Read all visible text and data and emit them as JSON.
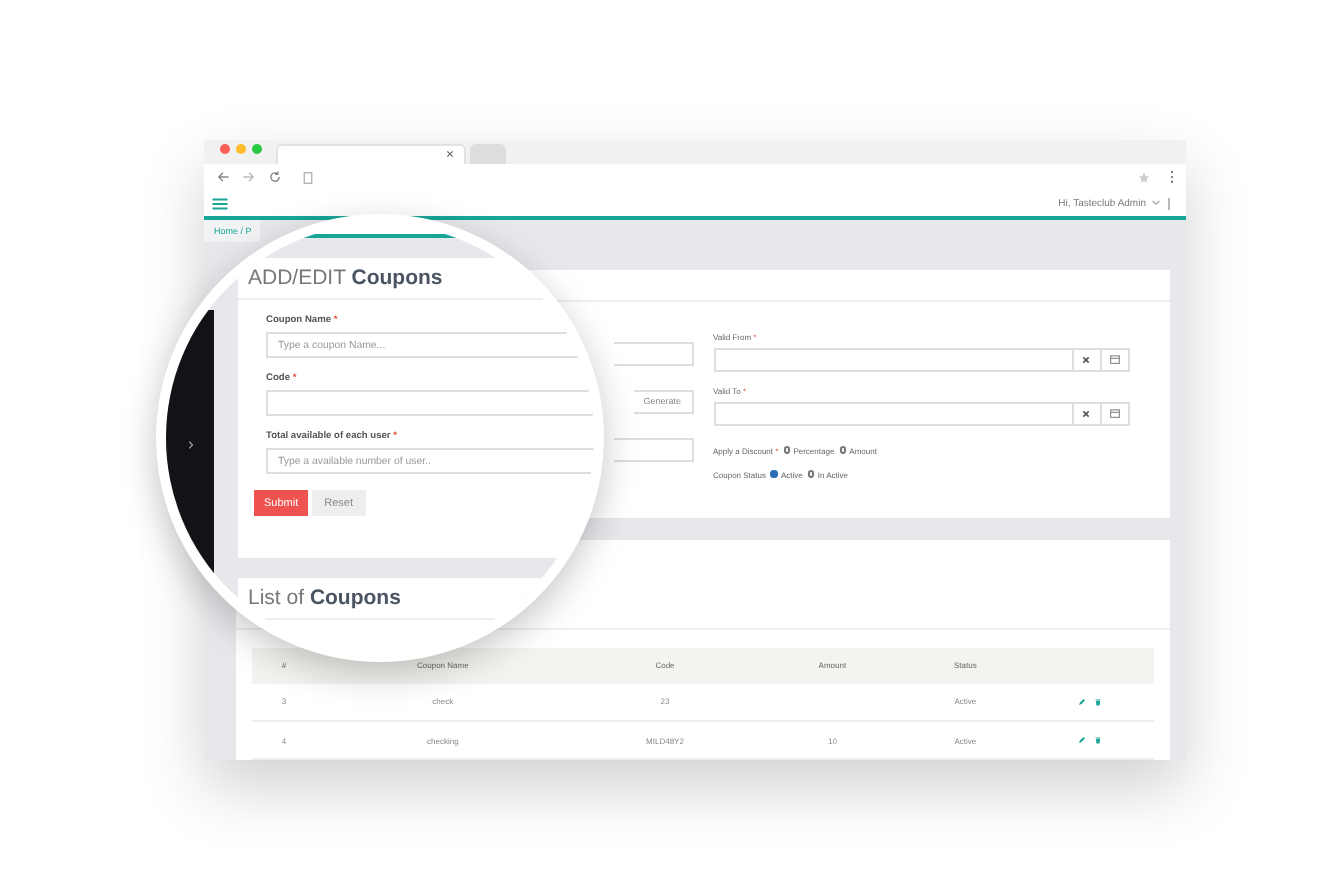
{
  "browser": {
    "tabs": [
      {
        "selected": true
      },
      {
        "selected": false
      }
    ]
  },
  "header": {
    "user_menu": "Hi, Tasteclub Admin"
  },
  "breadcrumb": "Home / P",
  "form": {
    "generate_button": "Generate",
    "right_fields": [
      {
        "label": "Valid From",
        "mark": "*"
      },
      {
        "label": "Valid To",
        "mark": "*"
      }
    ],
    "discount": {
      "label": "Apply a Discount",
      "mark": "*",
      "options": [
        {
          "label": "Percentage",
          "selected": false
        },
        {
          "label": "Amount",
          "selected": false
        }
      ]
    },
    "status": {
      "label": "Coupon Status",
      "options": [
        {
          "label": "Active",
          "selected": true
        },
        {
          "label": "In Active",
          "selected": false
        }
      ]
    }
  },
  "table": {
    "columns": [
      "#",
      "Coupon Name",
      "Code",
      "Amount",
      "Status"
    ],
    "rows": [
      {
        "cells": [
          "3",
          "check",
          "23",
          "",
          "Active"
        ]
      },
      {
        "cells": [
          "4",
          "checking",
          "MILD48Y2",
          "10",
          "Active"
        ]
      }
    ]
  },
  "magnifier": {
    "title_light": "ADD/EDIT",
    "title_bold": "Coupons",
    "fields": [
      {
        "label": "Coupon Name",
        "mark": "*",
        "placeholder": "Type a coupon Name..."
      },
      {
        "label": "Code",
        "mark": "*"
      },
      {
        "label": "Total available of each user",
        "mark": "*",
        "placeholder": "Type a available number of user.."
      }
    ],
    "submit_button": "Submit",
    "reset_button": "Reset",
    "list_title_light": "List of",
    "list_title_bold": "Coupons"
  }
}
